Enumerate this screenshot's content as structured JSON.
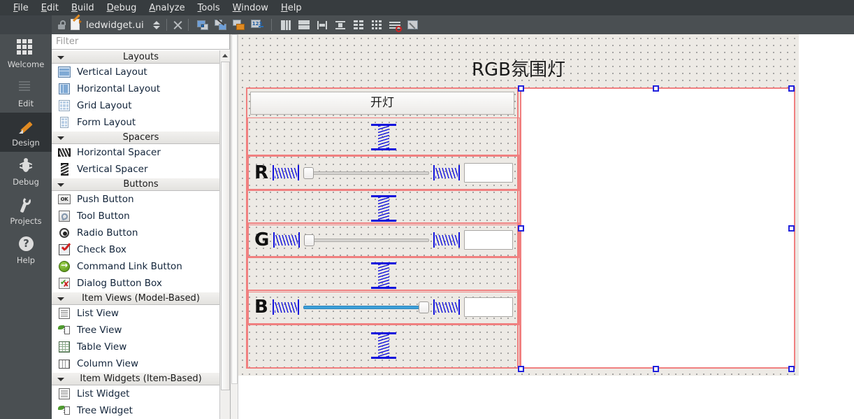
{
  "menu": {
    "items": [
      {
        "label": "File",
        "accel": "F"
      },
      {
        "label": "Edit",
        "accel": "E"
      },
      {
        "label": "Build",
        "accel": "B"
      },
      {
        "label": "Debug",
        "accel": "D"
      },
      {
        "label": "Analyze",
        "accel": "A"
      },
      {
        "label": "Tools",
        "accel": "T"
      },
      {
        "label": "Window",
        "accel": "W"
      },
      {
        "label": "Help",
        "accel": "H"
      }
    ]
  },
  "toolbar": {
    "document_title": "ledwidget.ui",
    "lock_icon": "unlocked-padlock-icon",
    "file_icon": "ui-file-icon",
    "buttons": [
      {
        "name": "split-selector",
        "icon": "up-down-arrows-icon"
      },
      {
        "name": "close-document",
        "icon": "close-x-icon"
      },
      {
        "name": "edit-widgets",
        "icon": "edit-widgets-icon"
      },
      {
        "name": "edit-signals-slots",
        "icon": "signals-slots-icon"
      },
      {
        "name": "edit-buddies",
        "icon": "buddies-icon"
      },
      {
        "name": "edit-tab-order",
        "icon": "tab-order-icon"
      },
      {
        "name": "layout-horizontally",
        "icon": "layout-horizontal-icon"
      },
      {
        "name": "layout-vertically",
        "icon": "layout-vertical-icon"
      },
      {
        "name": "layout-horizontally-in-splitter",
        "icon": "splitter-horizontal-icon"
      },
      {
        "name": "layout-vertically-in-splitter",
        "icon": "splitter-vertical-icon"
      },
      {
        "name": "layout-in-form-layout",
        "icon": "form-layout-icon"
      },
      {
        "name": "layout-in-grid",
        "icon": "grid-layout-icon"
      },
      {
        "name": "break-layout",
        "icon": "break-layout-icon"
      },
      {
        "name": "adjust-size",
        "icon": "adjust-size-icon"
      }
    ]
  },
  "modebar": {
    "items": [
      {
        "label": "Welcome",
        "icon": "grid-dots-icon",
        "active": false
      },
      {
        "label": "Edit",
        "icon": "document-lines-icon",
        "active": false
      },
      {
        "label": "Design",
        "icon": "pencil-icon",
        "active": true
      },
      {
        "label": "Debug",
        "icon": "bug-icon",
        "active": false
      },
      {
        "label": "Projects",
        "icon": "wrench-icon",
        "active": false
      },
      {
        "label": "Help",
        "icon": "question-mark-icon",
        "active": false
      }
    ]
  },
  "widgetbox": {
    "filter_placeholder": "Filter",
    "sections": [
      {
        "title": "Layouts",
        "collapsed": false,
        "items": [
          {
            "label": "Vertical Layout",
            "icon": "vertical-layout-icon"
          },
          {
            "label": "Horizontal Layout",
            "icon": "horizontal-layout-icon"
          },
          {
            "label": "Grid Layout",
            "icon": "grid-layout-icon"
          },
          {
            "label": "Form Layout",
            "icon": "form-layout-icon"
          }
        ]
      },
      {
        "title": "Spacers",
        "collapsed": false,
        "items": [
          {
            "label": "Horizontal Spacer",
            "icon": "horizontal-spacer-icon"
          },
          {
            "label": "Vertical Spacer",
            "icon": "vertical-spacer-icon"
          }
        ]
      },
      {
        "title": "Buttons",
        "collapsed": false,
        "items": [
          {
            "label": "Push Button",
            "icon": "push-button-icon"
          },
          {
            "label": "Tool Button",
            "icon": "tool-button-icon"
          },
          {
            "label": "Radio Button",
            "icon": "radio-button-icon"
          },
          {
            "label": "Check Box",
            "icon": "check-box-icon"
          },
          {
            "label": "Command Link Button",
            "icon": "command-link-button-icon"
          },
          {
            "label": "Dialog Button Box",
            "icon": "dialog-button-box-icon"
          }
        ]
      },
      {
        "title": "Item Views (Model-Based)",
        "collapsed": false,
        "items": [
          {
            "label": "List View",
            "icon": "list-view-icon"
          },
          {
            "label": "Tree View",
            "icon": "tree-view-icon"
          },
          {
            "label": "Table View",
            "icon": "table-view-icon"
          },
          {
            "label": "Column View",
            "icon": "column-view-icon"
          }
        ]
      },
      {
        "title": "Item Widgets (Item-Based)",
        "collapsed": false,
        "items": [
          {
            "label": "List Widget",
            "icon": "list-widget-icon"
          },
          {
            "label": "Tree Widget",
            "icon": "tree-widget-icon"
          }
        ]
      }
    ]
  },
  "form": {
    "title": "RGB氛围灯",
    "toggle_button_label": "开灯",
    "preview_panel": {
      "name": "led-preview-area",
      "value": ""
    },
    "channels": [
      {
        "label": "R",
        "slider_value": 0,
        "slider_min": 0,
        "slider_max": 100,
        "value_field": ""
      },
      {
        "label": "G",
        "slider_value": 0,
        "slider_min": 0,
        "slider_max": 100,
        "value_field": ""
      },
      {
        "label": "B",
        "slider_value": 100,
        "slider_min": 0,
        "slider_max": 100,
        "value_field": ""
      }
    ],
    "colors": {
      "layout_guide": "#f08080",
      "selection_handle": "#2222dd",
      "slider_fill": "#3d9fd8",
      "canvas_background": "#edeae5"
    }
  }
}
